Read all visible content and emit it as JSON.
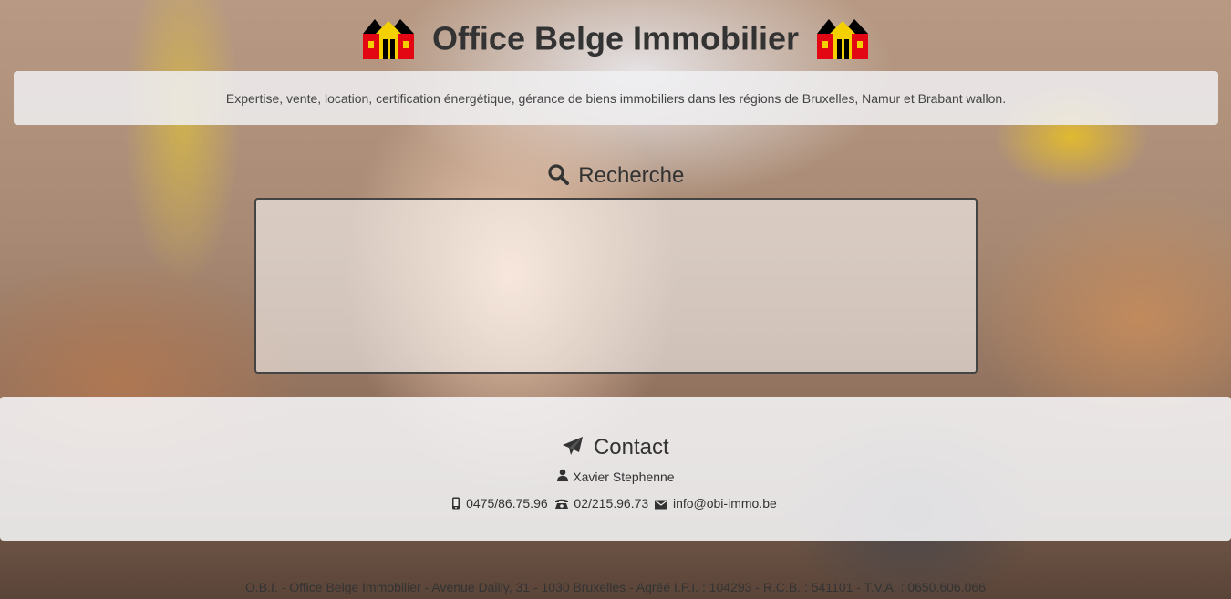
{
  "header": {
    "title": "Office Belge Immobilier",
    "tagline": "Expertise, vente, location, certification énergétique, gérance de biens immobiliers dans les régions de Bruxelles, Namur et Brabant wallon.",
    "logo_icon": "belgian-houses-logo",
    "logo_colors": [
      "#000000",
      "#f5d000",
      "#e30613"
    ]
  },
  "search": {
    "heading": "Recherche",
    "icon": "search-icon"
  },
  "contact": {
    "heading": "Contact",
    "icon": "paper-plane-icon",
    "person": "Xavier Stephenne",
    "mobile": "0475/86.75.96",
    "phone": "02/215.96.73",
    "email": "info@obi-immo.be"
  },
  "footer": {
    "text": "O.B.I. - Office Belge Immobilier - Avenue Dailly, 31 - 1030 Bruxelles - Agréé I.P.I. : 104293 - R.C.B. : 541101 - T.V.A. : 0650.606.066"
  }
}
